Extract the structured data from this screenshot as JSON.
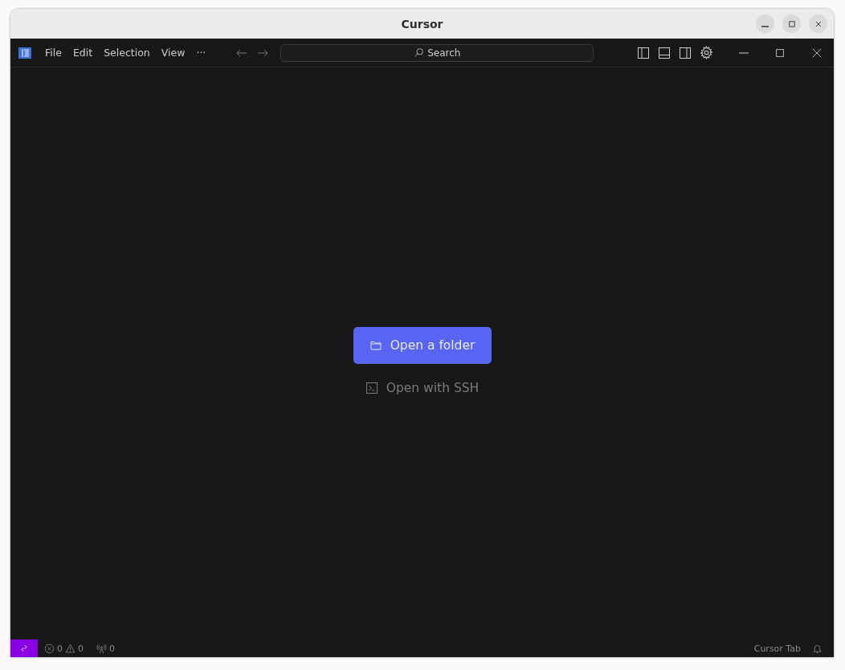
{
  "window": {
    "title": "Cursor"
  },
  "menu": [
    "File",
    "Edit",
    "Selection",
    "View",
    "···"
  ],
  "search": {
    "placeholder": "Search"
  },
  "actions": [
    {
      "label": "Open a folder",
      "kind": "primary"
    },
    {
      "label": "Open with SSH",
      "kind": "secondary"
    }
  ],
  "status_bar": {
    "errors": "0",
    "warnings": "0",
    "ports": "0",
    "right_label": "Cursor Tab"
  }
}
